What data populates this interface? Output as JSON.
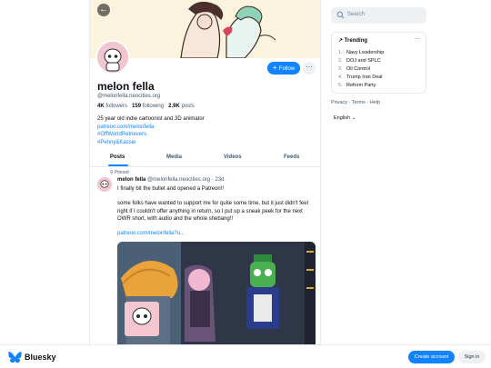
{
  "profile": {
    "display_name": "melon fella",
    "handle": "@melonfella.neocities.org",
    "followers_count": "4K",
    "followers_label": "followers",
    "following_count": "159",
    "following_label": "following",
    "posts_count": "2.9K",
    "posts_label": "posts",
    "bio_line": "25 year old indie cartoonist and 3D animator",
    "bio_link": "patreon.com/melonfella",
    "bio_tag1": "#OffWorldRetrievers",
    "bio_tag2": "#Penny&Kassie",
    "follow_label": "Follow"
  },
  "tabs": [
    "Posts",
    "Media",
    "Videos",
    "Feeds"
  ],
  "post": {
    "pinned_label": "Pinned",
    "author": "melon fella",
    "handle": "@melonfella.neocities.org",
    "age": "23d",
    "line1": "I finally bit the bullet and opened a Patreon!!",
    "line2": "some folks have wanted to support me for quite some time, but it just didn't feel right if I couldn't offer anything in return, so I put up a sneak peek for the next OWR short, with audio and the whole shebang!!",
    "link": "patreon.com/melonfella?u..."
  },
  "search": {
    "placeholder": "Search"
  },
  "trending": {
    "title": "Trending",
    "items": [
      "Navy Leadership",
      "DOJ and SPLC",
      "Oil Control",
      "Trump Iran Deal",
      "Reform Party"
    ]
  },
  "footer": {
    "privacy": "Privacy",
    "terms": "Terms",
    "help": "Help",
    "language": "English"
  },
  "bottom": {
    "brand": "Bluesky",
    "create": "Create account",
    "signin": "Sign in"
  },
  "colors": {
    "accent": "#1083fe",
    "banner": "#fbf3de"
  }
}
